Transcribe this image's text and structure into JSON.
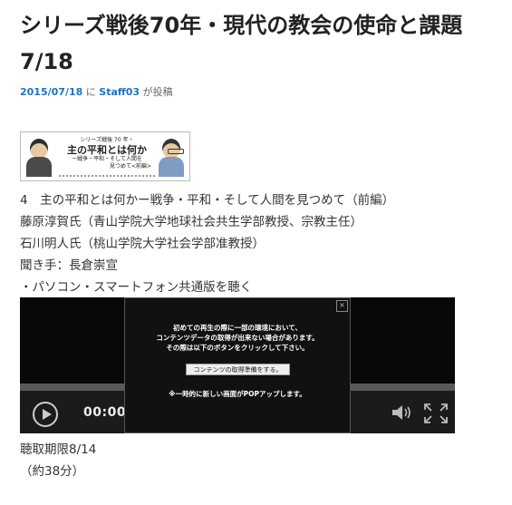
{
  "post": {
    "title_line1": "シリーズ戦後70年・現代の教会の使命と課題",
    "title_line2": "7/18",
    "date": "2015/07/18",
    "meta_ni": "に",
    "author": "Staff03",
    "meta_posted": "が投稿"
  },
  "banner": {
    "line1": "シリーズ戦後 70 年・",
    "line2": "主の平和とは何か",
    "line3": "ー戦争・平和・そして人間を",
    "line4": "見つめて<前編>"
  },
  "body": {
    "lines": [
      "4　主の平和とは何かー戦争・平和・そして人間を見つめて（前編）",
      "藤原淳賀氏（青山学院大学地球社会共生学部教授、宗教主任）",
      "石川明人氏（桃山学院大学社会学部准教授）",
      "聞き手：長倉崇宣",
      "・パソコン・スマートフォン共通版を聴く"
    ]
  },
  "player": {
    "time": "00:00:0",
    "popup": {
      "close": "×",
      "msg1": "初めての再生の際に一部の環境において、",
      "msg2": "コンテンツデータの取得が出来ない場合があります。",
      "msg3": "その際は以下のボタンをクリックして下さい。",
      "button": "コンテンツの取得準備をする。",
      "note": "※一時的に新しい画面がPOPアップします。"
    }
  },
  "footer": {
    "deadline": "聴取期限8/14",
    "duration": "（約38分）"
  }
}
